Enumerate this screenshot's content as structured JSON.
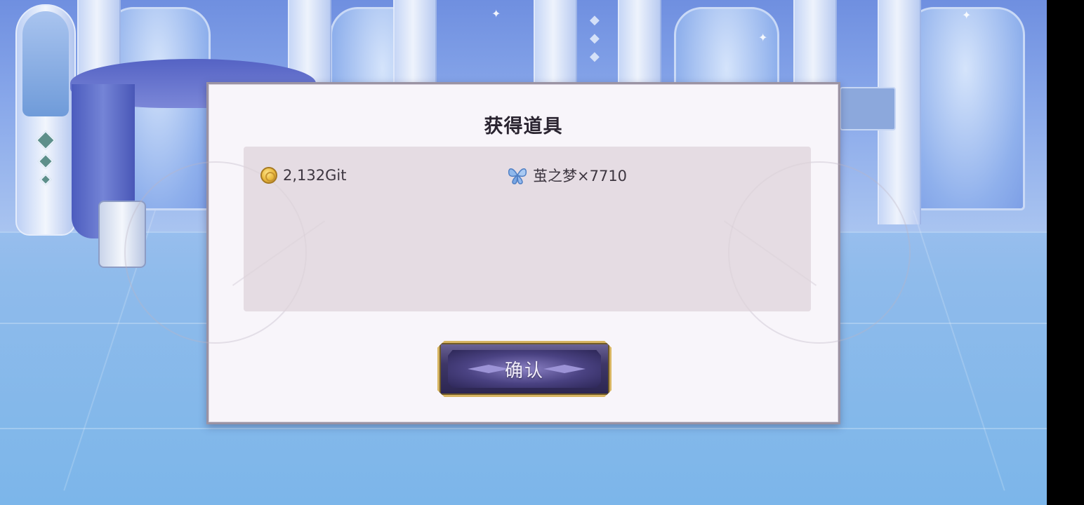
{
  "dialog": {
    "title": "获得道具",
    "items": [
      {
        "icon": "coin-icon",
        "label": "2,132Git"
      },
      {
        "icon": "butterfly-icon",
        "label": "茧之梦×7710"
      }
    ],
    "confirm_label": "确认"
  },
  "colors": {
    "dialog_bg": "#f8f5fa",
    "items_bg": "#e3dbe0",
    "button_gold": "#d8b562",
    "button_purple": "#3e3768"
  }
}
